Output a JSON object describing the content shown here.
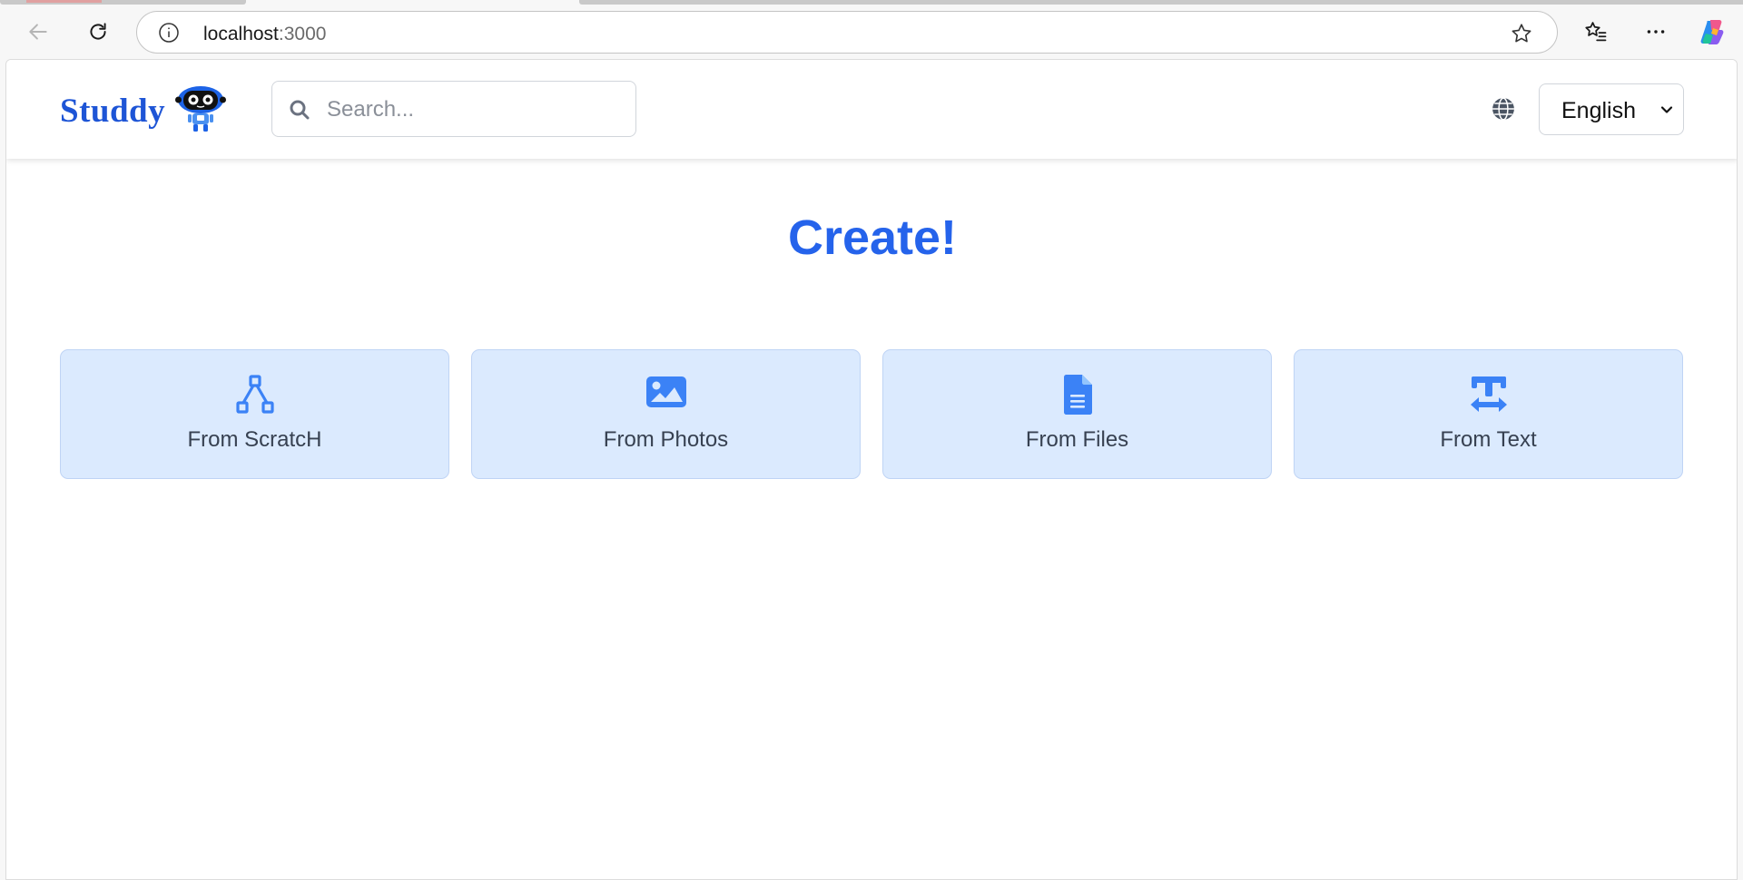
{
  "browser": {
    "url_host": "localhost",
    "url_port": ":3000"
  },
  "header": {
    "logo_text": "Studdy",
    "search_placeholder": "Search...",
    "language": "English"
  },
  "main": {
    "title": "Create!",
    "options": [
      {
        "label": "From ScratcH",
        "icon": "hierarchy-icon"
      },
      {
        "label": "From Photos",
        "icon": "image-icon"
      },
      {
        "label": "From Files",
        "icon": "file-icon"
      },
      {
        "label": "From Text",
        "icon": "text-width-icon"
      }
    ]
  },
  "colors": {
    "accent": "#2563eb",
    "card_bg": "#dbeafe",
    "logo": "#1e55d6"
  }
}
